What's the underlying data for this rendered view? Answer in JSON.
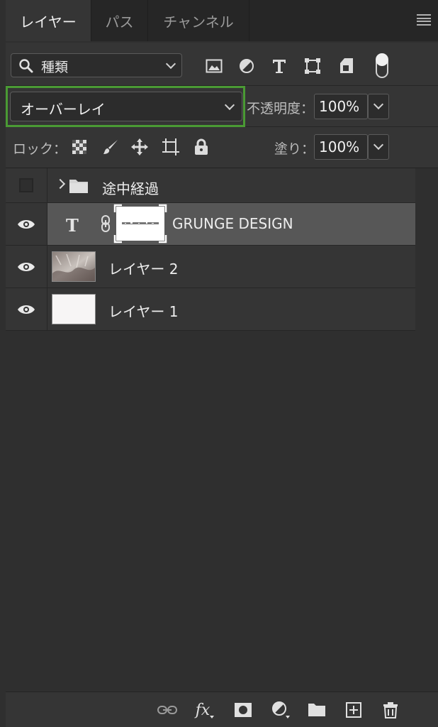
{
  "tabs": [
    {
      "label": "レイヤー",
      "active": true
    },
    {
      "label": "パス",
      "active": false
    },
    {
      "label": "チャンネル",
      "active": false
    }
  ],
  "filter": {
    "kind_label": "種類",
    "icons": [
      "image-filter-icon",
      "adjustment-filter-icon",
      "type-filter-icon",
      "shape-filter-icon",
      "smart-object-filter-icon"
    ]
  },
  "blend": {
    "mode": "オーバーレイ",
    "opacity_label": "不透明度：",
    "opacity_value": "100%"
  },
  "lock": {
    "label": "ロック：",
    "fill_label": "塗り：",
    "fill_value": "100%"
  },
  "layers": [
    {
      "name": "途中経過",
      "type": "group",
      "visible": false
    },
    {
      "name": "GRUNGE DESIGN",
      "type": "text",
      "visible": true,
      "selected": true
    },
    {
      "name": "レイヤー 2",
      "type": "image",
      "visible": true
    },
    {
      "name": "レイヤー 1",
      "type": "image",
      "visible": true
    }
  ],
  "bottom_toolbar": {
    "fx_label": "fx"
  },
  "colors": {
    "highlight_border": "#4a9a34",
    "panel_bg": "#353535",
    "selected_row": "#575757"
  }
}
